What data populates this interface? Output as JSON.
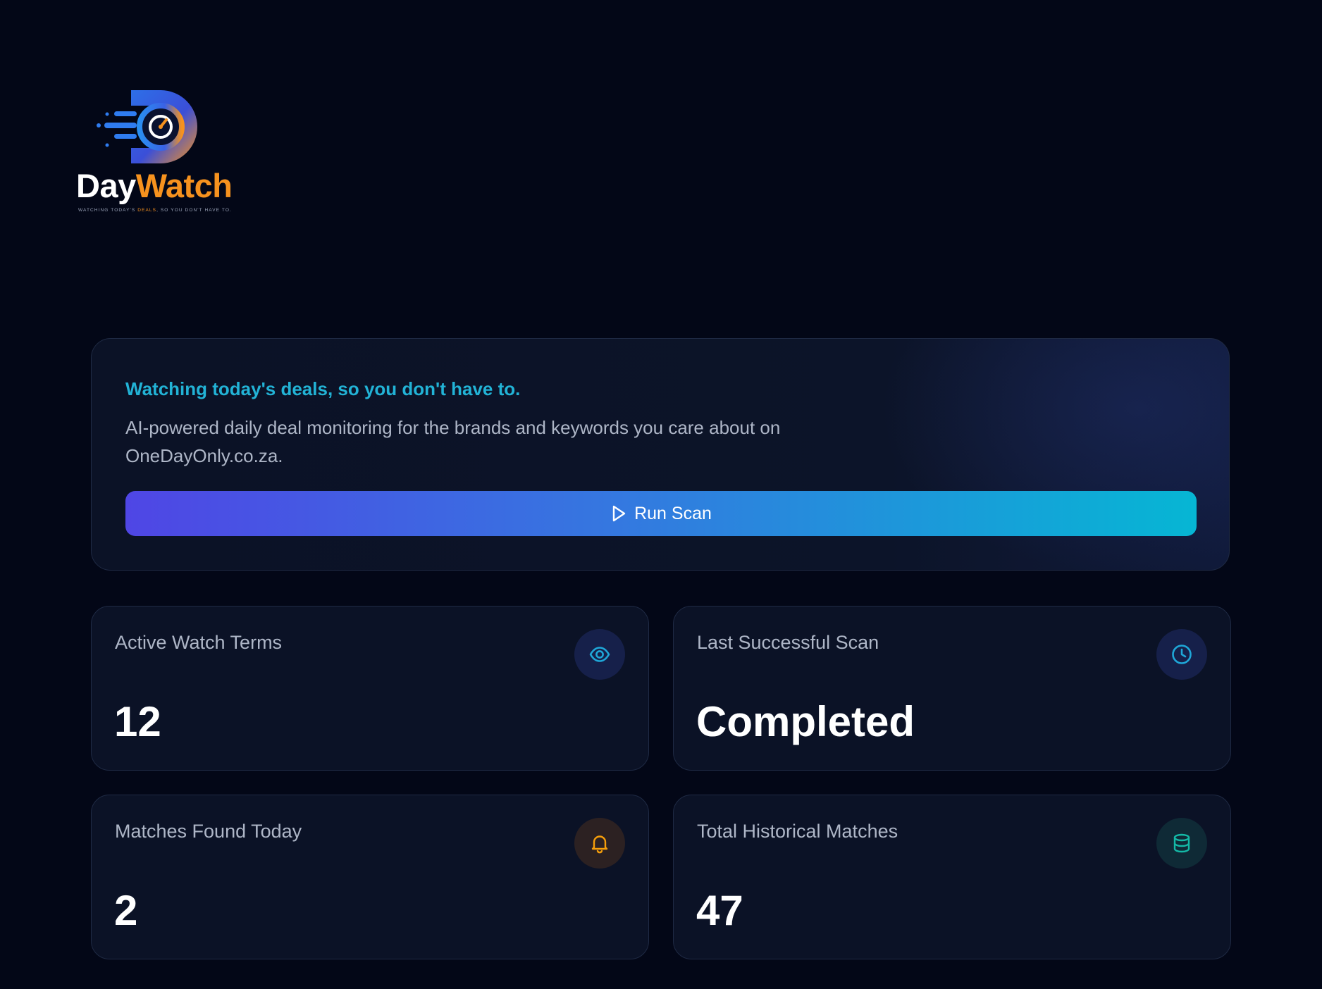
{
  "brand": {
    "name_part1": "Day",
    "name_part2": "Watch",
    "tagline_pre": "Watching today's ",
    "tagline_hl": "deals",
    "tagline_post": ", so you don't have to.",
    "colors": {
      "primary": "#2f6be3",
      "accent": "#f6921e"
    }
  },
  "hero": {
    "tagline": "Watching today's deals, so you don't have to.",
    "description": "AI-powered daily deal monitoring for the brands and keywords you care about on OneDayOnly.co.za.",
    "run_scan_label": "Run Scan",
    "run_scan_icon": "play-icon"
  },
  "stats": [
    {
      "label": "Active Watch Terms",
      "value": "12",
      "icon": "eye-icon",
      "color": "#1fa7d8"
    },
    {
      "label": "Last Successful Scan",
      "value": "Completed",
      "icon": "clock-icon",
      "color": "#1fa7d8"
    },
    {
      "label": "Matches Found Today",
      "value": "2",
      "icon": "bell-icon",
      "color": "#f59e0b"
    },
    {
      "label": "Total Historical Matches",
      "value": "47",
      "icon": "database-icon",
      "color": "#14b8a6"
    }
  ]
}
